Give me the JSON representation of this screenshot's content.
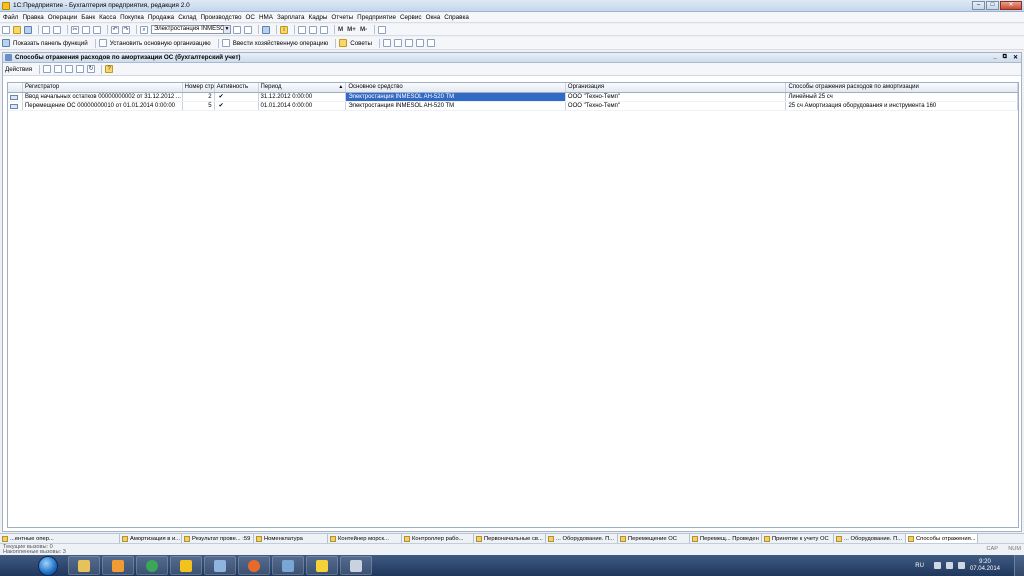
{
  "window": {
    "title": "1С:Предприятие - Бухгалтерия предприятия, редакция 2.0"
  },
  "menu": [
    "Файл",
    "Правка",
    "Операции",
    "Банк",
    "Касса",
    "Покупка",
    "Продажа",
    "Склад",
    "Производство",
    "ОС",
    "НМА",
    "Зарплата",
    "Кадры",
    "Отчеты",
    "Предприятие",
    "Сервис",
    "Окна",
    "Справка"
  ],
  "toolbar": {
    "search_value": "Электростанция INMESO",
    "m": "M",
    "m_plus": "M+",
    "m_minus": "M-"
  },
  "toolbar2": {
    "show_panel": "Показать панель функций",
    "set_org": "Установить основную организацию",
    "enter_op": "Ввести хозяйственную операцию",
    "tips": "Советы"
  },
  "form": {
    "title": "Способы отражения расходов по амортизации ОС (бухгалтерский учет)",
    "actions": "Действия"
  },
  "table": {
    "headers": [
      "Регистратор",
      "Номер стр...",
      "Активность",
      "Период",
      "Основное средство",
      "Организация",
      "Способы отражения расходов по амортизации"
    ],
    "rows": [
      {
        "registrar": "Ввод начальных остатков 00000000002 от 31.12.2012 ...",
        "line_no": "2",
        "active": "✔",
        "period": "31.12.2012 0:00:00",
        "asset": "Электростанция INMESOL AH-520 TM",
        "org": "ООО \"Техно-Темп\"",
        "method": "Линейный 25 сч"
      },
      {
        "registrar": "Перемещение ОС 00000000010 от 01.01.2014 0:00:00",
        "line_no": "5",
        "active": "✔",
        "period": "01.01.2014 0:00:00",
        "asset": "Электростанция INMESOL AH-520 TM",
        "org": "ООО \"Техно-Темп\"",
        "method": "25 сч  Амортизация оборудования и инструмента 160"
      }
    ]
  },
  "window_tabs": [
    "...ентные опер...",
    "Амортизация в и...",
    "Результат прове... :59",
    "Номенклатура",
    "Контейнер морск...",
    "Контроллер рабо...",
    "Первоначальные св...",
    "... Оборудование. П...",
    "Перемещение ОС",
    "Перемещ... Проведен",
    "Принятие к учету ОС",
    "... Оборудование. П...",
    "Способы отражения..."
  ],
  "status": {
    "line1": "Текущие вызовы: 0",
    "line2": "Накопленные вызовы: 3",
    "cap": "CAP",
    "num": "NUM"
  },
  "taskbar": {
    "apps": [
      {
        "icon": "explorer-icon",
        "color": "#e6c35a"
      },
      {
        "icon": "media-player-icon",
        "color": "#f29b32"
      },
      {
        "icon": "chrome-icon",
        "color": "#3aa757"
      },
      {
        "icon": "1c-icon",
        "color": "#f3c21c"
      },
      {
        "icon": "calculator-icon",
        "color": "#8fb4de"
      },
      {
        "icon": "firefox-icon",
        "color": "#e86a2a"
      },
      {
        "icon": "search-tool-icon",
        "color": "#7aa6d6"
      },
      {
        "icon": "1c-enterprise-icon",
        "color": "#f6d23a"
      },
      {
        "icon": "settings-app-icon",
        "color": "#c9d3df"
      }
    ],
    "lang": "RU",
    "time": "9:20",
    "date": "07.04.2014"
  }
}
